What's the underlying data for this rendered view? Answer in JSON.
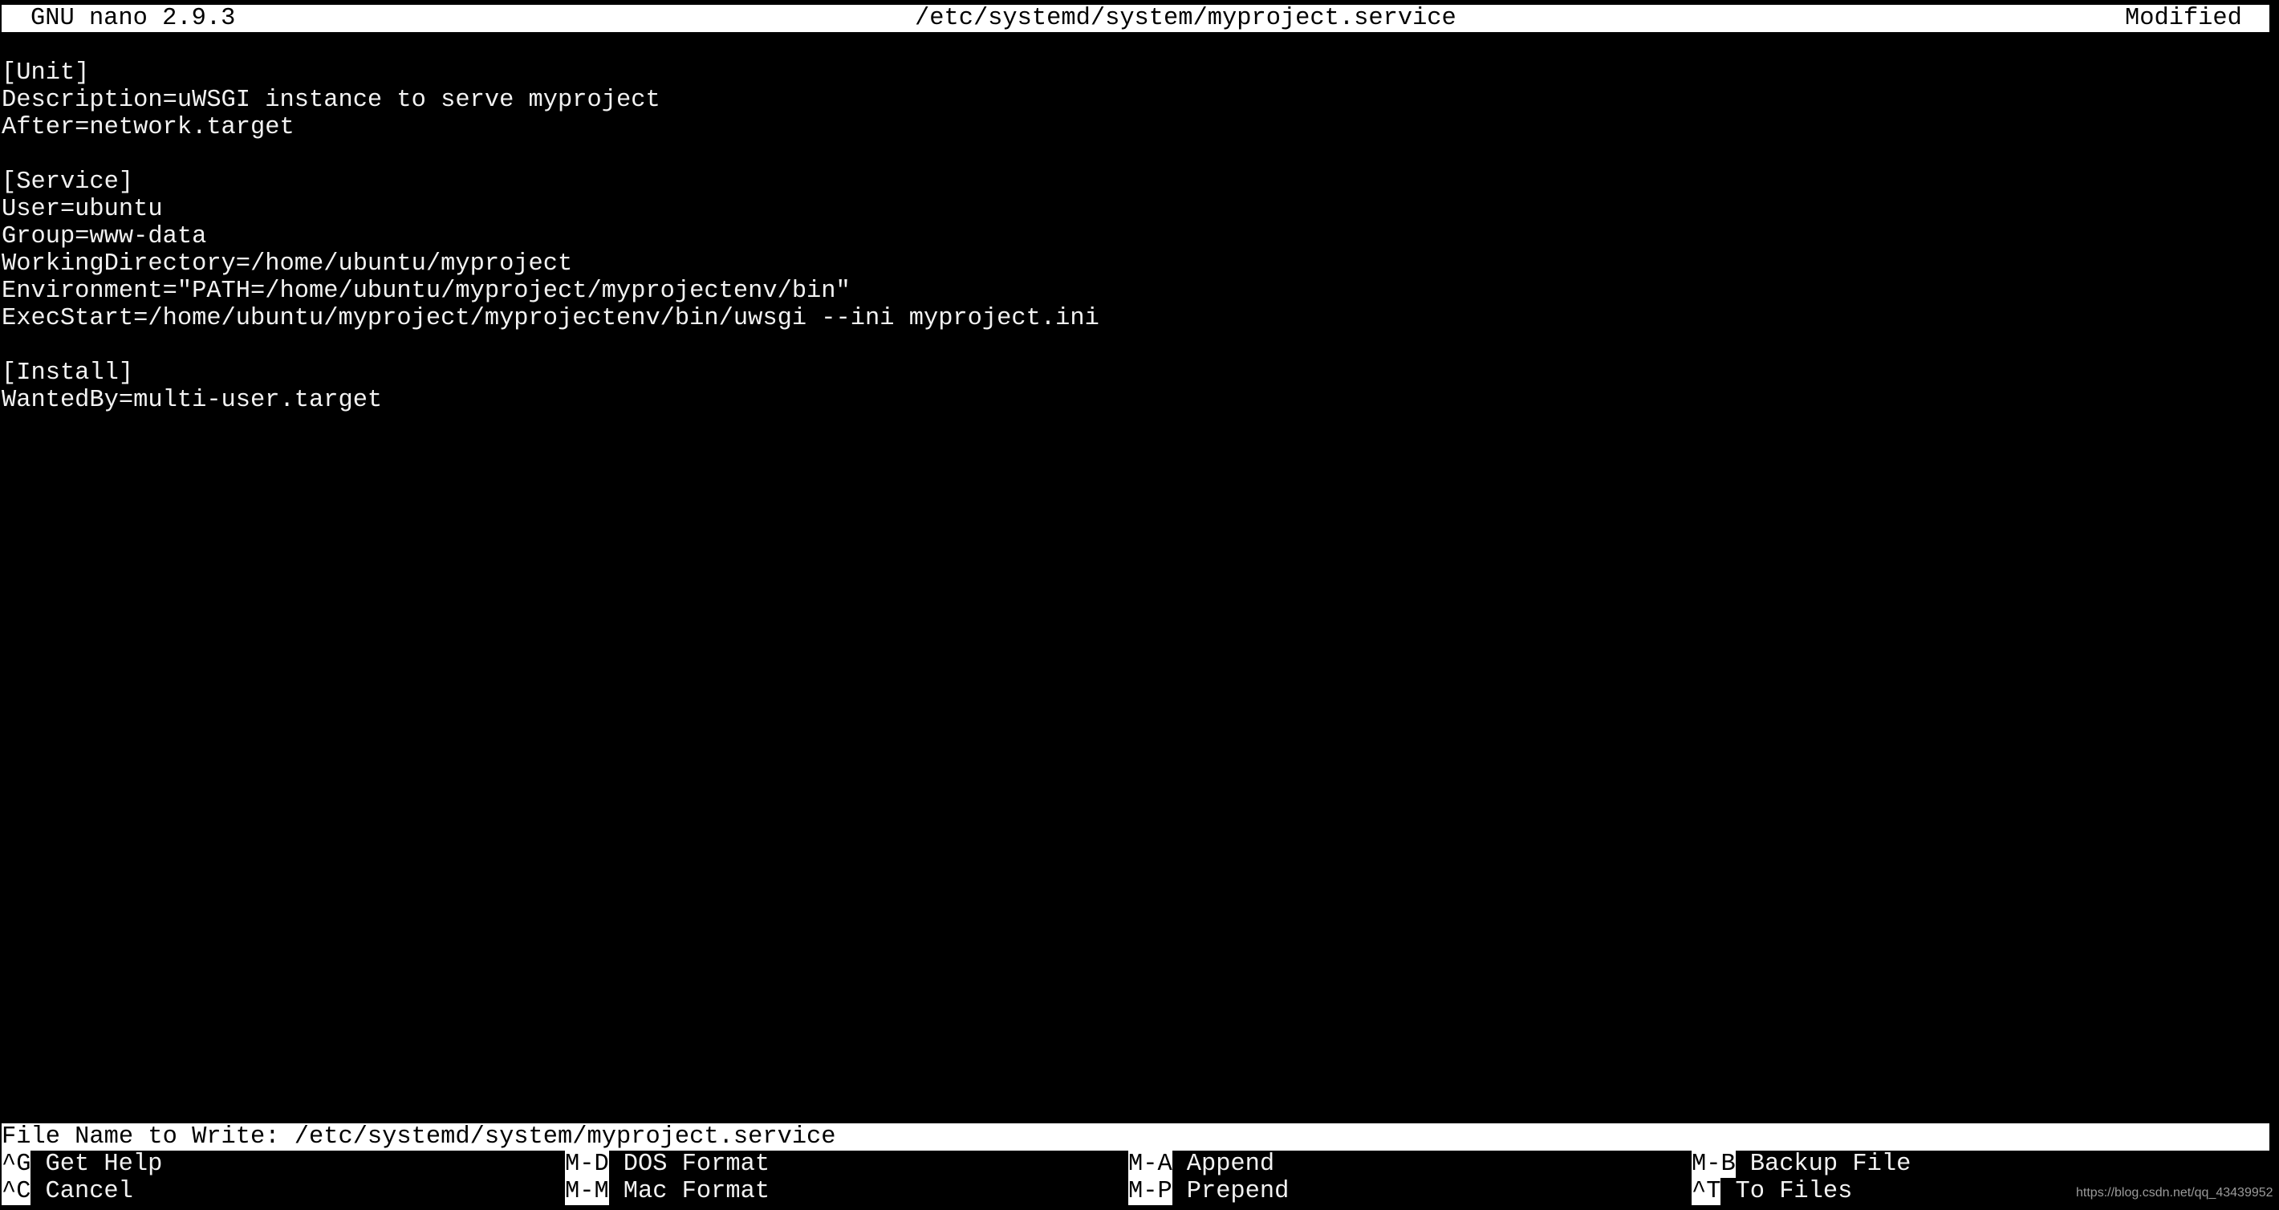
{
  "app": {
    "name": "GNU nano 2.9.3",
    "file_path": "/etc/systemd/system/myproject.service",
    "state": "Modified"
  },
  "editor": {
    "lines": [
      "[Unit]",
      "Description=uWSGI instance to serve myproject",
      "After=network.target",
      "",
      "[Service]",
      "User=ubuntu",
      "Group=www-data",
      "WorkingDirectory=/home/ubuntu/myproject",
      "Environment=\"PATH=/home/ubuntu/myproject/myprojectenv/bin\"",
      "ExecStart=/home/ubuntu/myproject/myprojectenv/bin/uwsgi --ini myproject.ini",
      "",
      "[Install]",
      "WantedBy=multi-user.target"
    ]
  },
  "prompt": {
    "label": "File Name to Write: ",
    "value": "/etc/systemd/system/myproject.service"
  },
  "shortcuts": {
    "rows": [
      [
        {
          "key": "^G",
          "label": "Get Help"
        },
        {
          "key": "M-D",
          "label": "DOS Format"
        },
        {
          "key": "M-A",
          "label": "Append"
        },
        {
          "key": "M-B",
          "label": "Backup File"
        }
      ],
      [
        {
          "key": "^C",
          "label": "Cancel"
        },
        {
          "key": "M-M",
          "label": "Mac Format"
        },
        {
          "key": "M-P",
          "label": "Prepend"
        },
        {
          "key": "^T",
          "label": "To Files"
        }
      ]
    ]
  },
  "watermark": "https://blog.csdn.net/qq_43439952"
}
